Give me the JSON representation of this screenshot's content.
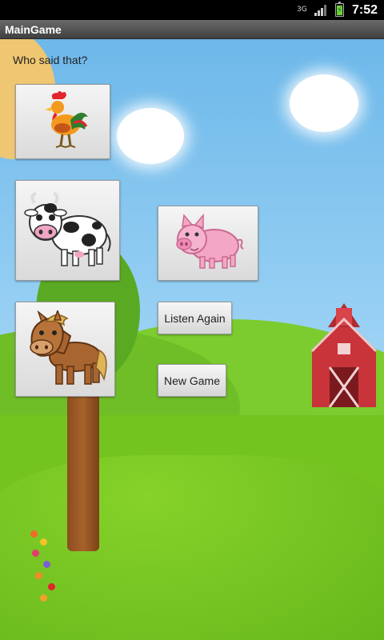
{
  "status_bar": {
    "network": "3G",
    "time": "7:52",
    "icons": [
      "signal-icon",
      "battery-charging-icon"
    ]
  },
  "title_bar": {
    "title": "MainGame"
  },
  "game": {
    "prompt": "Who said that?",
    "animals": [
      {
        "name": "rooster",
        "icon": "rooster-icon"
      },
      {
        "name": "cow",
        "icon": "cow-icon"
      },
      {
        "name": "pig",
        "icon": "pig-icon"
      },
      {
        "name": "horse",
        "icon": "horse-icon"
      }
    ],
    "listen_again_label": "Listen Again",
    "new_game_label": "New Game"
  },
  "colors": {
    "sky": "#7fc6f0",
    "grass": "#73c41f",
    "title_bar": "#4f4f4f",
    "barn": "#c8343a"
  }
}
